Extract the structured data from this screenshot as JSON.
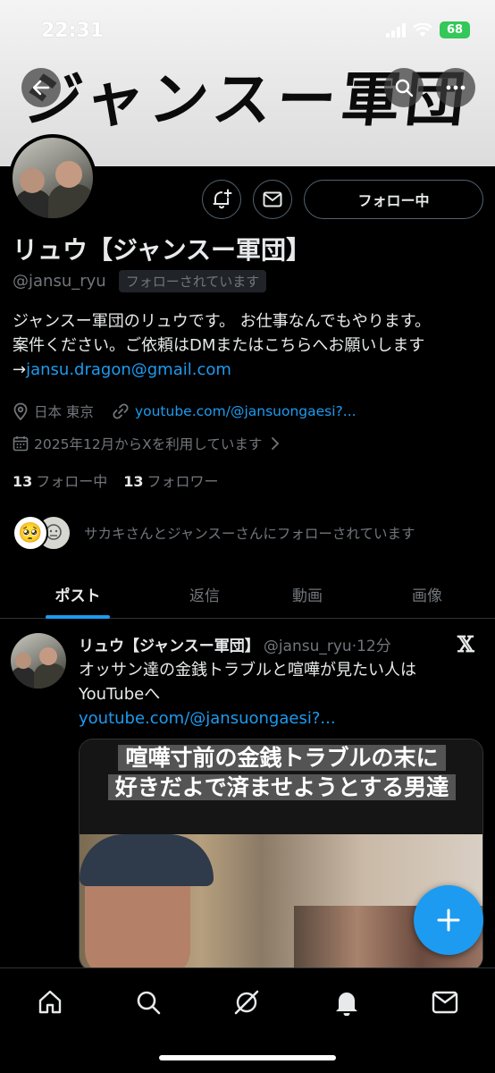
{
  "status_bar": {
    "time": "22:31",
    "battery": "68"
  },
  "banner": {
    "title": "ジャンスー軍団"
  },
  "profile": {
    "display_name": "リュウ【ジャンスー軍団】",
    "handle": "@jansu_ryu",
    "follows_you": "フォローされています",
    "follow_button": "フォロー中",
    "bio_line1": "ジャンスー軍団のリュウです。 お仕事なんでもやります。",
    "bio_line2": "案件ください。ご依頼はDMまたはこちらへお願いします",
    "bio_arrow": "→",
    "bio_email": "jansu.dragon@gmail.com",
    "location": "日本 東京",
    "website": "youtube.com/@jansuongaesi?...",
    "joined": "2025年12月からXを利用しています",
    "following_count": "13",
    "following_label": "フォロー中",
    "followers_count": "13",
    "followers_label": "フォロワー",
    "followed_by": "サカキさんとジャンスーさんにフォローされています",
    "followed_by_emoji": "🥺"
  },
  "tabs": [
    {
      "label": "ポスト",
      "active": true
    },
    {
      "label": "返信",
      "active": false
    },
    {
      "label": "動画",
      "active": false
    },
    {
      "label": "画像",
      "active": false
    }
  ],
  "post": {
    "name": "リュウ【ジャンスー軍団】",
    "handle": "@jansu_ryu",
    "separator": "·",
    "time": "12分",
    "x_logo": "𝕏",
    "text_line1": "オッサン達の金銭トラブルと喧嘩が見たい人は",
    "text_line2": "YouTubeへ",
    "link": "youtube.com/@jansuongaesi?...",
    "media_caption_line1": "喧嘩寸前の金銭トラブルの末に",
    "media_caption_line2": "好きだよで済ませようとする男達"
  },
  "colors": {
    "accent": "#1d9bf0",
    "background": "#000000",
    "muted": "#71767b",
    "battery": "#34c759"
  },
  "icons": [
    "back-icon",
    "search-icon",
    "more-icon",
    "bell-plus-icon",
    "mail-icon",
    "location-icon",
    "link-icon",
    "calendar-icon",
    "chevron-right-icon",
    "plus-icon",
    "home-icon",
    "grok-icon",
    "notification-icon",
    "messages-icon"
  ]
}
